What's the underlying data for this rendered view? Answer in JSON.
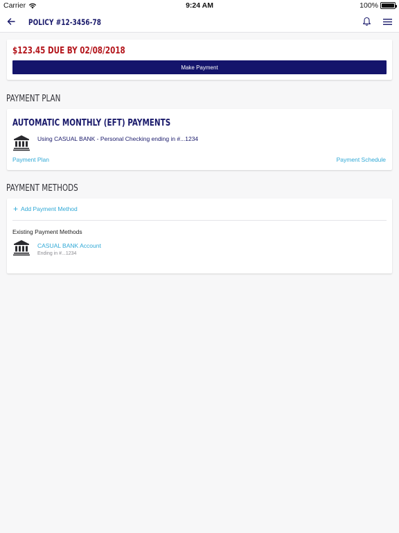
{
  "status_bar": {
    "carrier": "Carrier",
    "time": "9:24 AM",
    "battery": "100%"
  },
  "nav": {
    "title": "POLICY #12-3456-78",
    "back_icon": "arrow-left-icon",
    "bell_icon": "bell-icon",
    "menu_icon": "hamburger-menu-icon"
  },
  "due": {
    "text": "$123.45 DUE BY 02/08/2018",
    "button_label": "Make Payment"
  },
  "payment_plan": {
    "heading": "PAYMENT PLAN",
    "title": "AUTOMATIC MONTHLY (EFT) PAYMENTS",
    "description": "Using CASUAL BANK - Personal Checking ending in #...1234",
    "plan_link": "Payment Plan",
    "schedule_link": "Payment Schedule"
  },
  "payment_methods": {
    "heading": "PAYMENT METHODS",
    "add_label": "Add Payment Method",
    "existing_label": "Existing Payment Methods",
    "methods": [
      {
        "name": "CASUAL BANK Account",
        "detail": "Ending in #...1234"
      }
    ]
  },
  "colors": {
    "brand_navy": "#14146b",
    "due_red": "#b4171d",
    "link_blue": "#2fa8d6",
    "background": "#f7f7f8"
  }
}
